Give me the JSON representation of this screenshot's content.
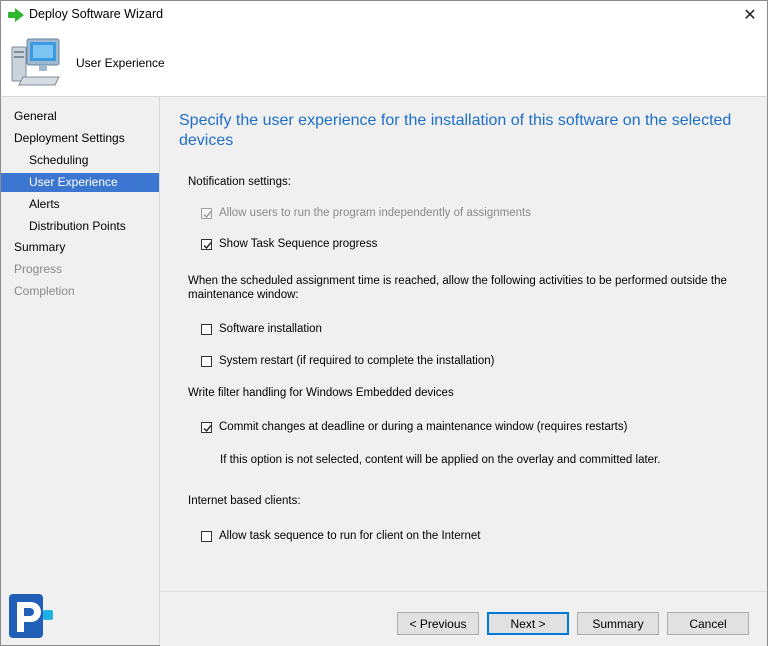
{
  "window": {
    "title": "Deploy Software Wizard",
    "close_glyph": "✕"
  },
  "banner": {
    "title": "User Experience",
    "icon": "computer-icon"
  },
  "nav": {
    "items": [
      {
        "label": "General",
        "level": "top",
        "state": "normal"
      },
      {
        "label": "Deployment Settings",
        "level": "top",
        "state": "normal"
      },
      {
        "label": "Scheduling",
        "level": "sub",
        "state": "normal"
      },
      {
        "label": "User Experience",
        "level": "sub",
        "state": "selected"
      },
      {
        "label": "Alerts",
        "level": "sub",
        "state": "normal"
      },
      {
        "label": "Distribution Points",
        "level": "sub",
        "state": "normal"
      },
      {
        "label": "Summary",
        "level": "top",
        "state": "normal"
      },
      {
        "label": "Progress",
        "level": "top",
        "state": "disabled"
      },
      {
        "label": "Completion",
        "level": "top",
        "state": "disabled"
      }
    ],
    "selected_color": "#3b76d0"
  },
  "content": {
    "heading": "Specify the user experience for the installation of this software on the selected devices",
    "notification_label": "Notification settings:",
    "allow_independent": {
      "label": "Allow users to run the program independently of assignments",
      "checked": true,
      "disabled": true
    },
    "show_progress": {
      "label": "Show Task Sequence progress",
      "checked": true,
      "disabled": false
    },
    "maintenance_label": "When the scheduled assignment time is reached, allow the following activities to be performed outside the maintenance window:",
    "software_installation": {
      "label": "Software installation",
      "checked": false
    },
    "system_restart": {
      "label": "System restart  (if required to complete the installation)",
      "checked": false
    },
    "write_filter_label": "Write filter handling for Windows Embedded devices",
    "commit_changes": {
      "label": "Commit changes at deadline or during a maintenance window (requires restarts)",
      "checked": true
    },
    "commit_note": "If this option is not selected, content will be applied on the overlay and committed later.",
    "internet_label": "Internet based clients:",
    "allow_internet": {
      "label": "Allow task sequence to run for client on the Internet",
      "checked": false
    },
    "heading_color": "#1e6fc8"
  },
  "footer": {
    "previous": "< Previous",
    "next": "Next >",
    "summary": "Summary",
    "cancel": "Cancel"
  }
}
